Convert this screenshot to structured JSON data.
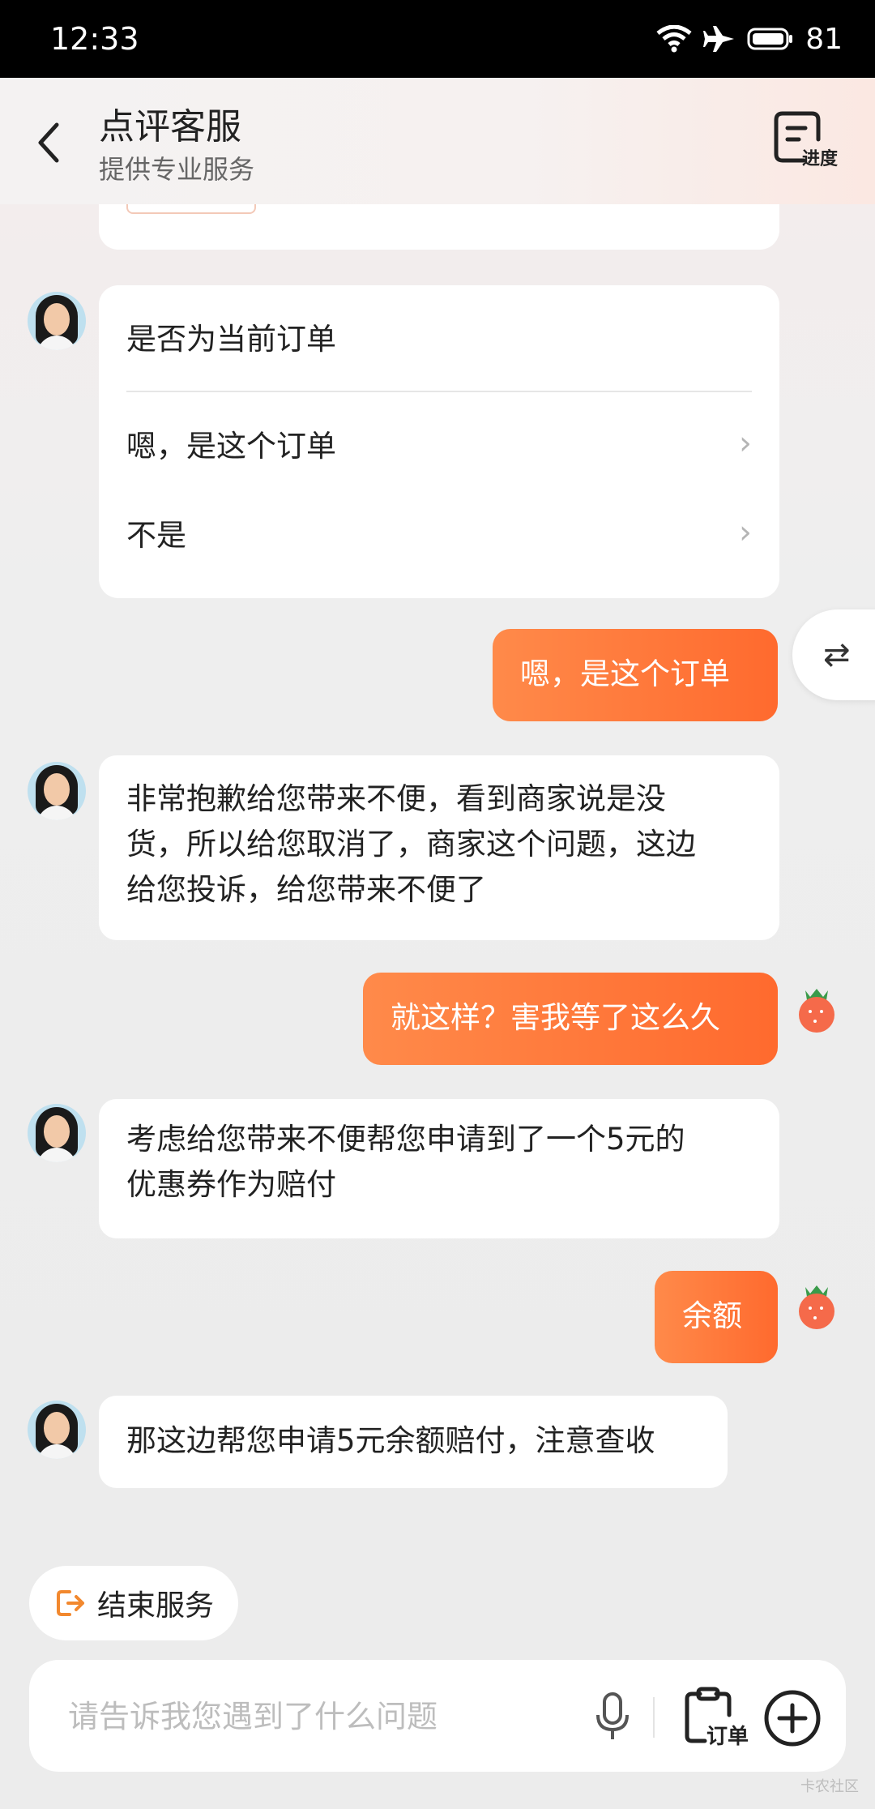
{
  "status_bar": {
    "time": "12:33",
    "battery": "81"
  },
  "header": {
    "title": "点评客服",
    "subtitle": "提供专业服务",
    "progress_label": "进度"
  },
  "option_card": {
    "question": "是否为当前订单",
    "options": [
      "嗯，是这个订单",
      "不是"
    ]
  },
  "messages": {
    "m1": "嗯，是这个订单",
    "m2_line1": "非常抱歉给您带来不便，看到商家说是没",
    "m2_line2": "货，所以给您取消了，商家这个问题，这边",
    "m2_line3": "给您投诉，给您带来不便了",
    "m3": "就这样？害我等了这么久",
    "m4_line1": "考虑给您带来不便帮您申请到了一个5元的",
    "m4_line2": "优惠券作为赔付",
    "m5": "余额",
    "m6": "那这边帮您申请5元余额赔付，注意查收"
  },
  "footer": {
    "end_service": "结束服务",
    "input_placeholder": "请告诉我您遇到了什么问题",
    "order_label": "订单"
  },
  "watermark": "卡农社区",
  "colors": {
    "accent": "#ff6a2e",
    "accent_light": "#ff8a4a"
  }
}
